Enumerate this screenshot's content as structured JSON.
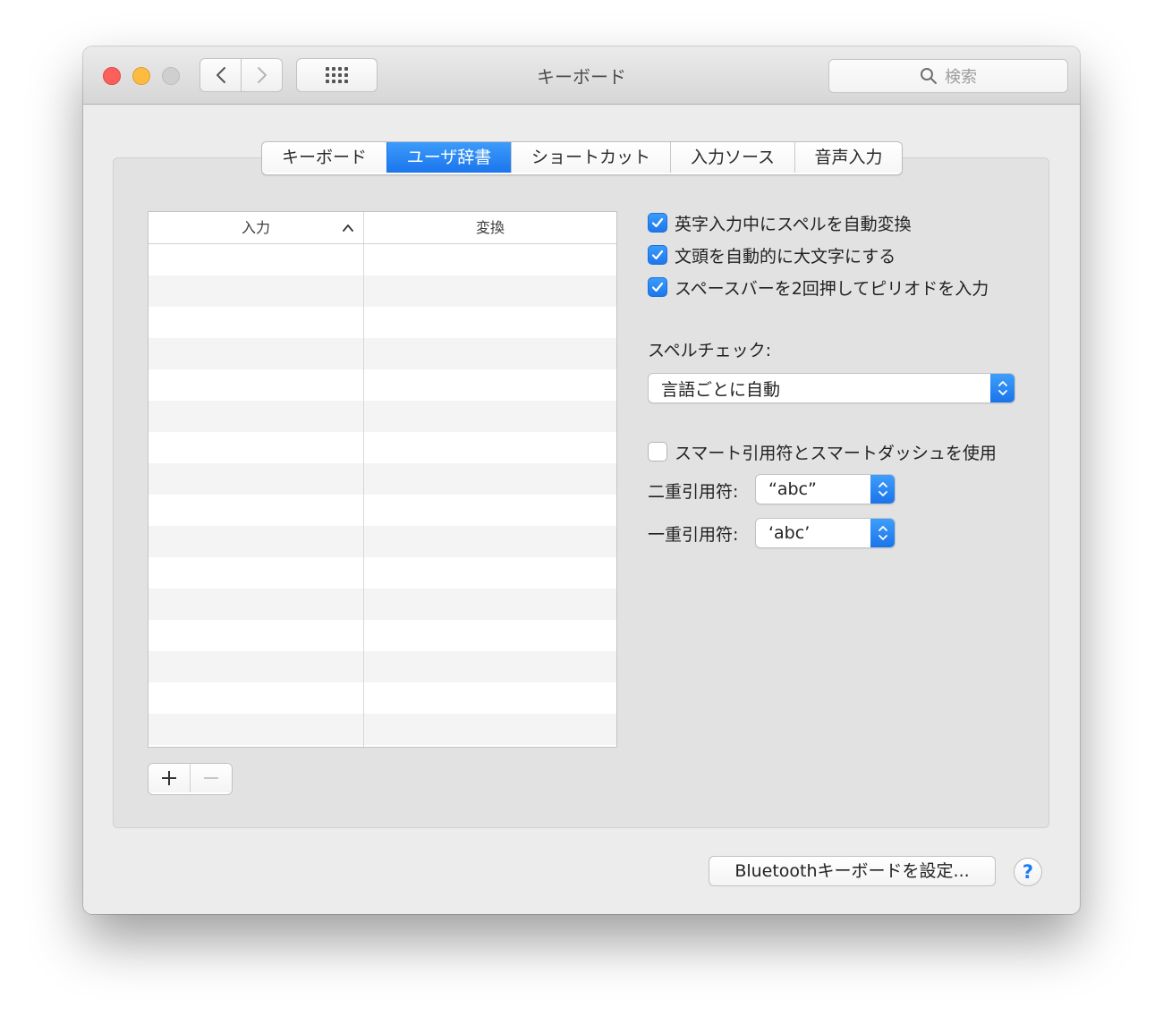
{
  "window": {
    "title": "キーボード"
  },
  "toolbar": {
    "search_placeholder": "検索"
  },
  "tabs": [
    {
      "label": "キーボード",
      "active": false
    },
    {
      "label": "ユーザ辞書",
      "active": true
    },
    {
      "label": "ショートカット",
      "active": false
    },
    {
      "label": "入力ソース",
      "active": false
    },
    {
      "label": "音声入力",
      "active": false
    }
  ],
  "dictionary_table": {
    "columns": [
      "入力",
      "変換"
    ],
    "rows": []
  },
  "options": {
    "auto_correct_spelling": {
      "label": "英字入力中にスペルを自動変換",
      "checked": true
    },
    "auto_capitalize": {
      "label": "文頭を自動的に大文字にする",
      "checked": true
    },
    "double_space_period": {
      "label": "スペースバーを2回押してピリオドを入力",
      "checked": true
    },
    "spell_check_label": "スペルチェック:",
    "spell_check_value": "言語ごとに自動",
    "smart_quotes": {
      "label": "スマート引用符とスマートダッシュを使用",
      "checked": false
    },
    "double_quote_label": "二重引用符:",
    "double_quote_value": "“abc”",
    "single_quote_label": "一重引用符:",
    "single_quote_value": "‘abc’"
  },
  "footer": {
    "bluetooth_button": "Bluetoothキーボードを設定...",
    "help_label": "?"
  },
  "colors": {
    "accent": "#1b76ec",
    "close": "#fc605c",
    "minimize": "#fdbc40"
  }
}
